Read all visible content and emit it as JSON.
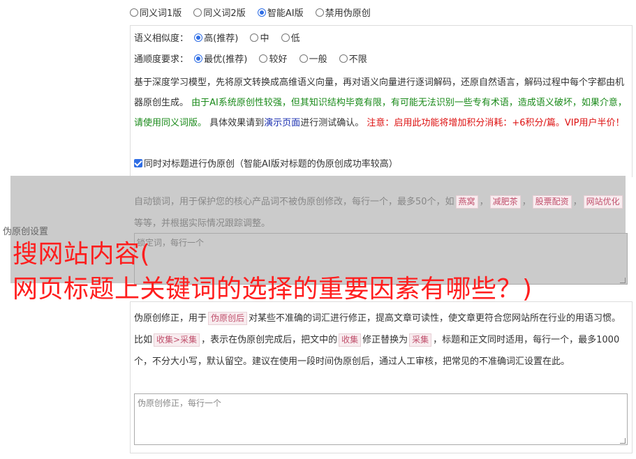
{
  "modes": [
    {
      "label": "同义词1版",
      "checked": false
    },
    {
      "label": "同义词2版",
      "checked": false
    },
    {
      "label": "智能AI版",
      "checked": true
    },
    {
      "label": "禁用伪原创",
      "checked": false
    }
  ],
  "similarity": {
    "label": "语义相似度：",
    "options": [
      {
        "label": "高(推荐)",
        "checked": true
      },
      {
        "label": "中",
        "checked": false
      },
      {
        "label": "低",
        "checked": false
      }
    ]
  },
  "fluency": {
    "label": "通顺度要求：",
    "options": [
      {
        "label": "最优(推荐)",
        "checked": true
      },
      {
        "label": "较好",
        "checked": false
      },
      {
        "label": "一般",
        "checked": false
      },
      {
        "label": "不限",
        "checked": false
      }
    ]
  },
  "description": {
    "part1": "基于深度学习模型，先将原文转换成高维语义向量，再对语义向量进行逐词解码，还原自然语言，解码过程中每个字都由机器原创生成。",
    "part2_green": "由于AI系统原创性较强，但其知识结构毕竟有限，有可能无法识别一些专有术语，造成语义破坏，如果介意，请使用同义词版。",
    "part3": "具体效果请到",
    "link": "演示页面",
    "part4": "进行测试确认。",
    "notice_red": "注意：启用此功能将增加积分消耗：+6积分/篇。VIP用户半价！"
  },
  "title_checkbox": {
    "label": "同时对标题进行伪原创（智能AI版对标题的伪原创成功率较高）",
    "checked": true
  },
  "section_label": "伪原创设置",
  "lock_words": {
    "desc_start": "自动锁词，用于保护您的核心产品词不被伪原创修改，每行一个，最多50个，如",
    "examples": [
      "燕窝",
      "减肥茶",
      "股票配资",
      "网站优化"
    ],
    "sep": "，",
    "desc_end": "等等，并根据实际情况跟踪调整。",
    "prefix": "锁定词",
    "placeholder": "，每行一个"
  },
  "overlay": {
    "line1": "搜网站内容(",
    "line2": "网页标题上关键词的选择的重要因素有哪些？)"
  },
  "correction": {
    "desc1": "伪原创修正，用于",
    "tag1": "伪原创后",
    "desc2": "对某些不准确的词汇进行修正，提高文章可读性，使文章更符合您网站所在行业的用语习惯。比如",
    "tag2": "收集>采集",
    "desc3": "，表示在伪原创完成后，把文中的",
    "tag3": "收集",
    "desc4": "修正替换为",
    "tag4": "采集",
    "desc5": "，标题和正文同时适用，每行一个，最多1000个，不分大小写，默认留空。建议在使用一段时间伪原创后，通过人工审核，把常见的不准确词汇设置在此。",
    "placeholder": "伪原创修正，每行一个"
  }
}
